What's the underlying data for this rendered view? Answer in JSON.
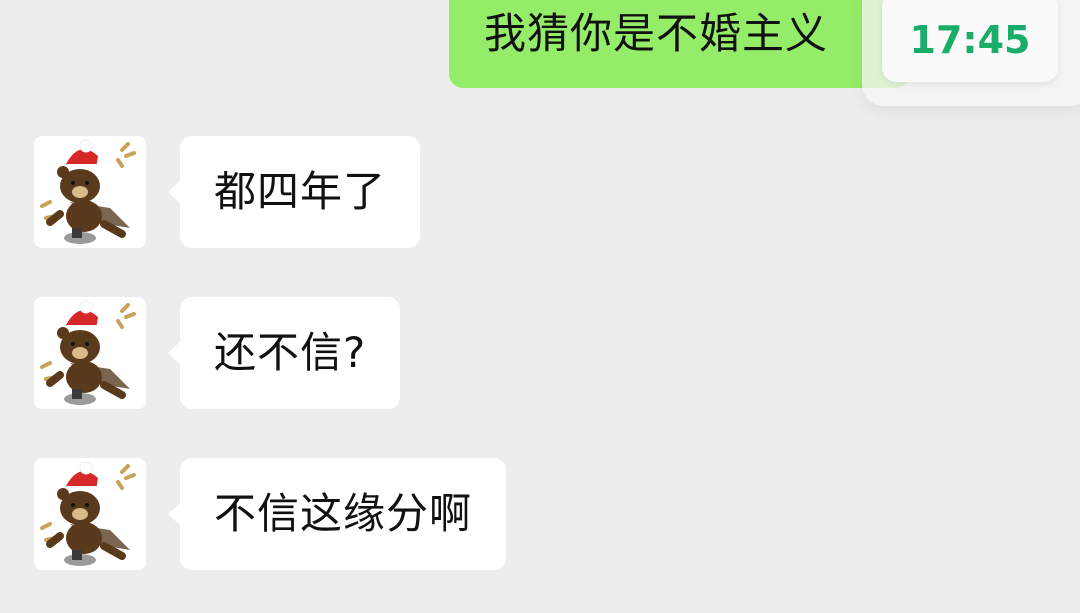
{
  "colors": {
    "background": "#ededed",
    "sent_bubble": "#95ec69",
    "received_bubble": "#ffffff",
    "time_text": "#1aad6a"
  },
  "time_popup": {
    "time": "17:45"
  },
  "sent": [
    {
      "text": "我猜你是不婚主义"
    }
  ],
  "received": [
    {
      "text": "都四年了",
      "avatar": "bear-with-santa-hat-avatar"
    },
    {
      "text": "还不信?",
      "avatar": "bear-with-santa-hat-avatar"
    },
    {
      "text": "不信这缘分啊",
      "avatar": "bear-with-santa-hat-avatar"
    }
  ]
}
